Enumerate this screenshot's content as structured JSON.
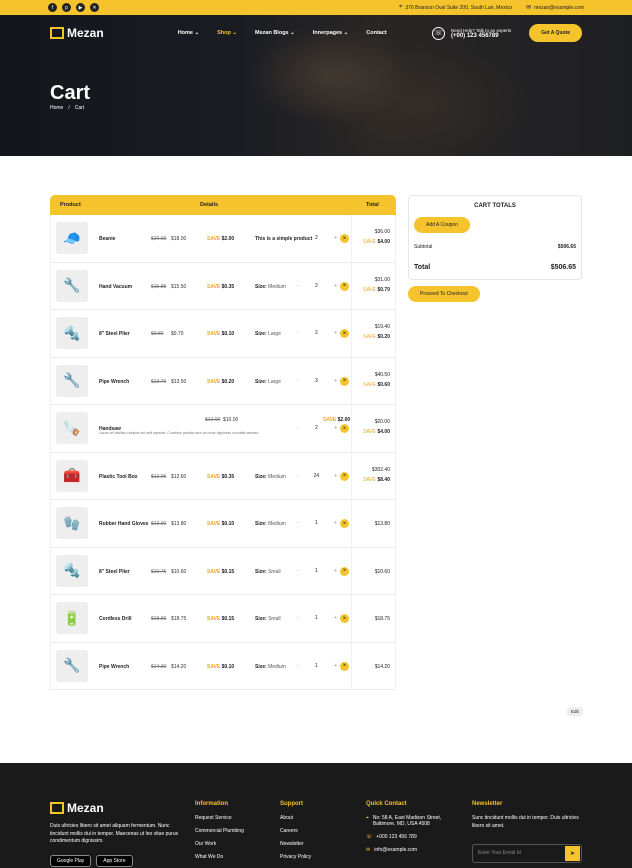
{
  "topbar": {
    "social": [
      "f",
      "p",
      "▶",
      "✕"
    ],
    "address": "376 Branson Oval Suite 200, South Lan, Mexico",
    "email": "mezan@example.com"
  },
  "nav": {
    "logo": "Mezan",
    "items": [
      "Home ⌄",
      "Shop ⌄",
      "Mezan Blogs ⌄",
      "Innerpages ⌄",
      "Contact"
    ],
    "help_label": "Need Help? Talk to an experts",
    "help_phone": "(+00) 123 456789",
    "quote": "Get A Quote"
  },
  "hero": {
    "title": "Cart",
    "crumb_home": "Home",
    "crumb_sep": "/",
    "crumb_current": "Cart"
  },
  "table": {
    "headers": [
      "Product",
      "Details",
      "Total"
    ],
    "rows": [
      {
        "name": "Beanie",
        "old": "$20.00",
        "new": "$18.00",
        "save": "SAVE",
        "save_amt": "$2.00",
        "size_label": "This is a simple product",
        "size": "",
        "qty": "2",
        "total": "$36.00",
        "row_save": "SAVE",
        "row_save_amt": "$4.00",
        "icon": "🧢"
      },
      {
        "name": "Hand Vacuum",
        "old": "$15.85",
        "new": "$15.50",
        "save": "SAVE",
        "save_amt": "$0.35",
        "size_label": "Size:",
        "size": "Medium",
        "qty": "2",
        "total": "$31.00",
        "row_save": "SAVE",
        "row_save_amt": "$0.70",
        "icon": "🔧"
      },
      {
        "name": "8\" Steel Plier",
        "old": "$9.80",
        "new": "$9.70",
        "save": "SAVE",
        "save_amt": "$0.10",
        "size_label": "Size:",
        "size": "Large",
        "qty": "2",
        "total": "$19.40",
        "row_save": "SAVE",
        "row_save_amt": "$0.20",
        "icon": "🔩"
      },
      {
        "name": "Pipe Wrench",
        "old": "$13.70",
        "new": "$13.50",
        "save": "SAVE",
        "save_amt": "$0.20",
        "size_label": "Size:",
        "size": "Large",
        "qty": "3",
        "total": "$40.50",
        "row_save": "SAVE",
        "row_save_amt": "$0.60",
        "icon": "🔧"
      },
      {
        "name": "Handsaw",
        "old": "$12.00",
        "new": "$10.00",
        "save": "SAVE",
        "save_amt": "$2.00",
        "size_label": "",
        "size": "",
        "qty": "2",
        "total": "$20.00",
        "row_save": "SAVE",
        "row_save_amt": "$4.00",
        "icon": "🪚",
        "desc": "Lacus vel facilisis volutpat est velit egestas. Curabitur gravida arcu ac tortor dignissim convallis aenean..."
      },
      {
        "name": "Plastic Tool Box",
        "old": "$12.95",
        "new": "$12.60",
        "save": "SAVE",
        "save_amt": "$0.35",
        "size_label": "Size:",
        "size": "Medium",
        "qty": "24",
        "total": "$302.40",
        "row_save": "SAVE",
        "row_save_amt": "$8.40",
        "icon": "🧰"
      },
      {
        "name": "Rubber Hand Gloves",
        "old": "$13.90",
        "new": "$13.80",
        "save": "SAVE",
        "save_amt": "$0.10",
        "size_label": "Size:",
        "size": "Medium",
        "qty": "1",
        "total": "$13.80",
        "row_save": "",
        "row_save_amt": "",
        "icon": "🧤"
      },
      {
        "name": "8\" Steel Plier",
        "old": "$10.75",
        "new": "$10.60",
        "save": "SAVE",
        "save_amt": "$0.15",
        "size_label": "Size:",
        "size": "Small",
        "qty": "1",
        "total": "$10.60",
        "row_save": "",
        "row_save_amt": "",
        "icon": "🔩"
      },
      {
        "name": "Cordless Drill",
        "old": "$18.90",
        "new": "$18.75",
        "save": "SAVE",
        "save_amt": "$0.15",
        "size_label": "Size:",
        "size": "Small",
        "qty": "1",
        "total": "$18.75",
        "row_save": "",
        "row_save_amt": "",
        "icon": "🔋"
      },
      {
        "name": "Pipe Wrench",
        "old": "$14.30",
        "new": "$14.20",
        "save": "SAVE",
        "save_amt": "$0.10",
        "size_label": "Size:",
        "size": "Medium",
        "qty": "1",
        "total": "$14.20",
        "row_save": "",
        "row_save_amt": "",
        "icon": "🔧"
      }
    ]
  },
  "totals": {
    "title": "CART TOTALS",
    "coupon": "Add A Coupon",
    "subtotal_label": "Subtotal",
    "subtotal": "$506.65",
    "total_label": "Total",
    "total": "$506.65",
    "checkout": "Proceed To Checkout"
  },
  "edit": "Edit",
  "footer": {
    "logo": "Mezan",
    "desc": "Duis ultricies libero sit amet aliquam fermentum. Nunc tincidunt mollis dui in tempor. Maecenas ut leo vitae purus condimentum dignissim.",
    "stores": [
      "Google Play",
      "App Store"
    ],
    "information": {
      "title": "Information",
      "items": [
        "Request Service",
        "Commercial Plumbing",
        "Our Work",
        "What We Do"
      ]
    },
    "support": {
      "title": "Support",
      "items": [
        "About",
        "Careers",
        "Newsletter",
        "Privacy Policy"
      ]
    },
    "contact": {
      "title": "Quick Contact",
      "address": "No: 58 A, East Madison Street, Baltimore, MD, USA 4508",
      "phone": "+000 123 456 789",
      "email": "info@example.com"
    },
    "newsletter": {
      "title": "Newsletter",
      "desc": "Sunc tincidunt mollis dui in tempor. Duis ultricies libero sit amet.",
      "placeholder": "Enter Your Email Id",
      "button": "➤"
    }
  }
}
